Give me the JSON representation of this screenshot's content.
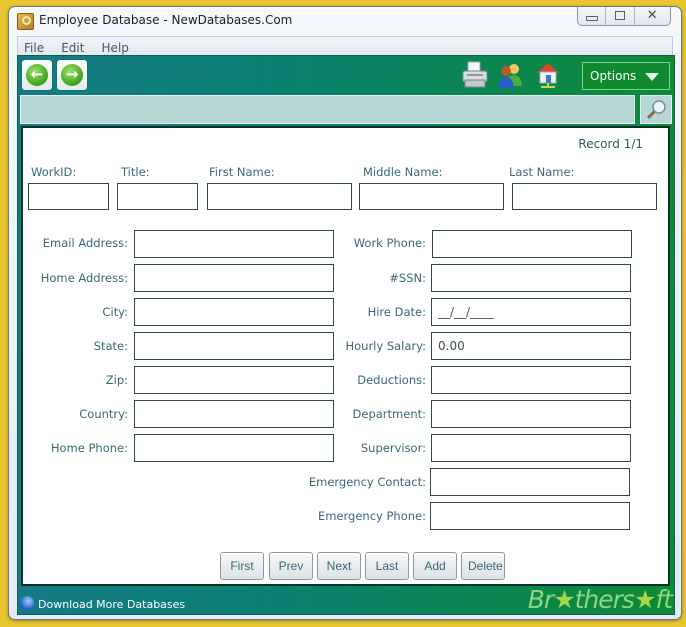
{
  "window": {
    "title": "Employee Database - NewDatabases.Com",
    "caption_close": "✕"
  },
  "menu": [
    "File",
    "Edit",
    "Help"
  ],
  "toolbar": {
    "back_glyph": "←",
    "forward_glyph": "→",
    "options_label": "Options",
    "icons": [
      "printer-icon",
      "users-icon",
      "home-network-icon"
    ]
  },
  "search": {
    "value": "",
    "placeholder": ""
  },
  "form": {
    "record_label": "Record 1/1",
    "top_fields": [
      {
        "label": "WorkID:",
        "value": ""
      },
      {
        "label": "Title:",
        "value": ""
      },
      {
        "label": "First Name:",
        "value": ""
      },
      {
        "label": "Middle Name:",
        "value": ""
      },
      {
        "label": "Last Name:",
        "value": ""
      }
    ],
    "left_fields": [
      {
        "label": "Email Address:",
        "value": ""
      },
      {
        "label": "Home Address:",
        "value": ""
      },
      {
        "label": "City:",
        "value": ""
      },
      {
        "label": "State:",
        "value": ""
      },
      {
        "label": "Zip:",
        "value": ""
      },
      {
        "label": "Country:",
        "value": ""
      },
      {
        "label": "Home Phone:",
        "value": ""
      }
    ],
    "right_fields": [
      {
        "label": "Work Phone:",
        "value": ""
      },
      {
        "label": "#SSN:",
        "value": ""
      },
      {
        "label": "Hire Date:",
        "value": "__/__/____"
      },
      {
        "label": "Hourly Salary:",
        "value": "0.00"
      },
      {
        "label": "Deductions:",
        "value": ""
      },
      {
        "label": "Department:",
        "value": ""
      },
      {
        "label": "Supervisor:",
        "value": ""
      },
      {
        "label": "Emergency Contact:",
        "value": ""
      },
      {
        "label": "Emergency Phone:",
        "value": ""
      }
    ],
    "buttons": [
      "First",
      "Prev",
      "Next",
      "Last",
      "Add",
      "Delete"
    ]
  },
  "footer": {
    "link": "Download More Databases",
    "watermark_a": "Br",
    "watermark_b": "thers",
    "watermark_c": "ft",
    "star": "★"
  }
}
